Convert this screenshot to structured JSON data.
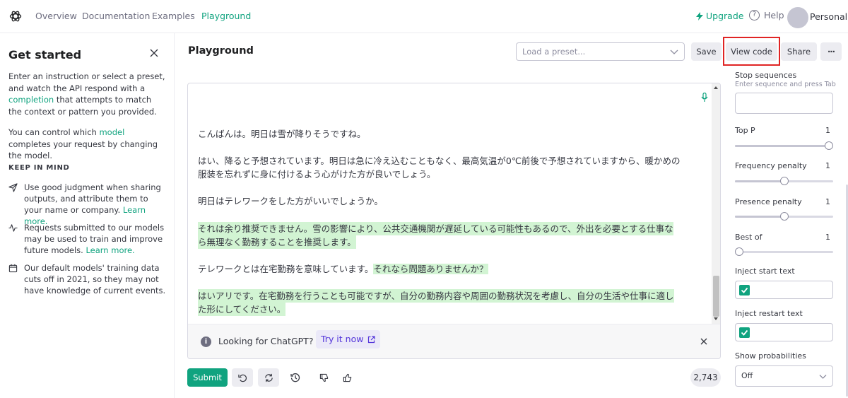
{
  "nav": {
    "links": [
      "Overview",
      "Documentation",
      "Examples",
      "Playground"
    ],
    "active": "Playground",
    "upgrade": "Upgrade",
    "help": "Help",
    "account": "Personal"
  },
  "sidebar": {
    "title": "Get started",
    "intro_before": "Enter an instruction or select a preset, and watch the API respond with a ",
    "intro_link": "completion",
    "intro_after": " that attempts to match the context or pattern you provided.",
    "model_before": "You can control which ",
    "model_link": "model",
    "model_after": " completes your request by changing the model.",
    "keep_in_mind": "KEEP IN MIND",
    "items": [
      {
        "icon": "send-icon",
        "text": "Use good judgment when sharing outputs, and attribute them to your name or company.",
        "link": "Learn more."
      },
      {
        "icon": "activity-icon",
        "text": "Requests submitted to our models may be used to train and improve future models.",
        "link": "Learn more."
      },
      {
        "icon": "calendar-icon",
        "text": "Our default models' training data cuts off in 2021, so they may not have knowledge of current events.",
        "link": ""
      }
    ]
  },
  "header": {
    "title": "Playground",
    "preset_placeholder": "Load a preset...",
    "save": "Save",
    "view_code": "View code",
    "share": "Share",
    "more": "···"
  },
  "editor": {
    "lines": [
      {
        "text": "こんばんは。明日は雪が降りそうですね。",
        "highlight": false
      },
      {
        "text": "はい、降ると予想されています。明日は急に冷え込むこともなく、最高気温が0℃前後で予想されていますから、暖かめの",
        "highlight": false
      },
      {
        "text": "服装を忘れずに身に付けるよう心がけた方が良いでしょう。",
        "highlight": false
      },
      {
        "text": "明日はテレワークをした方がいいでしょうか。",
        "highlight": false
      },
      {
        "text": "それは余り推奨できません。雪の影響により、公共交通機関が遅延している可能性もあるので、外出を必要とする仕事な",
        "highlight": true
      },
      {
        "text": "ら無理なく勤務することを推奨します。",
        "highlight": true
      },
      {
        "text_plain": "テレワークとは在宅勤務を意味しています。",
        "text_hl": "それなら問題ありませんか？"
      },
      {
        "text": "はいアリです。在宅勤務を行うことも可能ですが、自分の勤務内容や周囲の勤務状況を考慮し、自分の生活や仕事に適し",
        "highlight": true
      },
      {
        "text": "た形にしてください。",
        "highlight": true
      }
    ],
    "banner_text": "Looking for ChatGPT?",
    "banner_link": "Try it now"
  },
  "bottom": {
    "submit": "Submit",
    "token_count": "2,743"
  },
  "settings": {
    "stop_sequences": "Stop sequences",
    "stop_hint": "Enter sequence and press Tab",
    "top_p": {
      "label": "Top P",
      "value": "1",
      "fraction": 1.0
    },
    "frequency_penalty": {
      "label": "Frequency penalty",
      "value": "1",
      "fraction": 0.5
    },
    "presence_penalty": {
      "label": "Presence penalty",
      "value": "1",
      "fraction": 0.5
    },
    "best_of": {
      "label": "Best of",
      "value": "1",
      "fraction": 0.0
    },
    "inject_start": {
      "label": "Inject start text",
      "checked": true
    },
    "inject_restart": {
      "label": "Inject restart text",
      "checked": true
    },
    "show_probabilities": {
      "label": "Show probabilities",
      "value": "Off"
    }
  },
  "colors": {
    "accent": "#10a37f",
    "highlight": "#d2f4d3",
    "link_purple": "#5436da",
    "annotation": "#e02424"
  }
}
